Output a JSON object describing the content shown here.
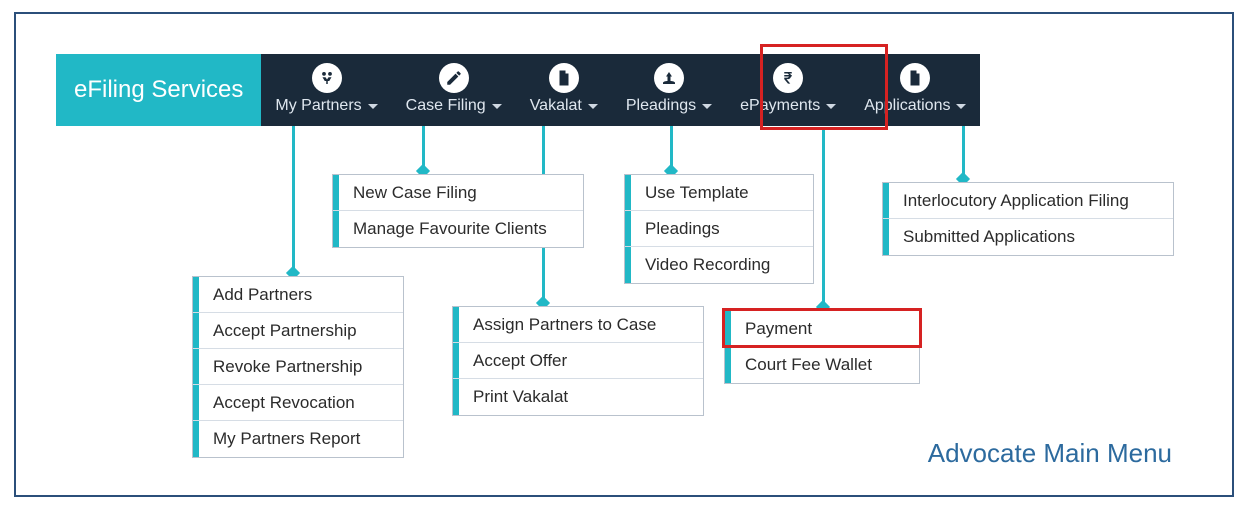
{
  "brand": "eFiling Services",
  "nav": {
    "my_partners": "My Partners",
    "case_filing": "Case Filing",
    "vakalat": "Vakalat",
    "pleadings": "Pleadings",
    "epayments": "ePayments",
    "applications": "Applications"
  },
  "menus": {
    "my_partners": {
      "0": "Add Partners",
      "1": "Accept Partnership",
      "2": "Revoke Partnership",
      "3": "Accept Revocation",
      "4": "My Partners Report"
    },
    "case_filing": {
      "0": "New Case Filing",
      "1": "Manage Favourite Clients"
    },
    "vakalat": {
      "0": "Assign Partners to Case",
      "1": "Accept Offer",
      "2": "Print Vakalat"
    },
    "pleadings": {
      "0": "Use Template",
      "1": "Pleadings",
      "2": "Video Recording"
    },
    "epayments": {
      "0": "Payment",
      "1": "Court Fee Wallet"
    },
    "applications": {
      "0": "Interlocutory Application Filing",
      "1": "Submitted Applications"
    }
  },
  "caption": "Advocate Main Menu"
}
